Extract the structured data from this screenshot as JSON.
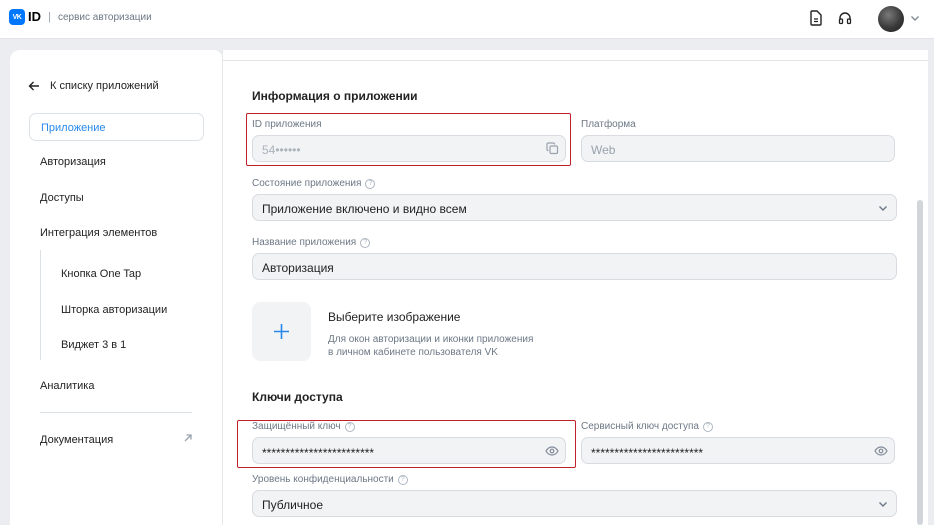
{
  "header": {
    "logo_badge": "VK",
    "logo_id": "ID",
    "separator": "|",
    "subtitle": "сервис авторизации"
  },
  "sidebar": {
    "back_label": "К списку приложений",
    "items": [
      {
        "label": "Приложение",
        "active": true
      },
      {
        "label": "Авторизация"
      },
      {
        "label": "Доступы"
      },
      {
        "label": "Интеграция элементов"
      }
    ],
    "sub_items": [
      {
        "label": "Кнопка One Tap"
      },
      {
        "label": "Шторка авторизации"
      },
      {
        "label": "Виджет 3 в 1"
      }
    ],
    "analytics_label": "Аналитика",
    "docs_label": "Документация"
  },
  "app_info": {
    "title": "Информация о приложении",
    "app_id_label": "ID приложения",
    "app_id_value": "54••••••",
    "platform_label": "Платформа",
    "platform_value": "Web",
    "state_label": "Состояние приложения",
    "state_value": "Приложение включено и видно всем",
    "name_label": "Название приложения",
    "name_value": "Авторизация",
    "image_title": "Выберите изображение",
    "image_desc_line1": "Для окон авторизации и иконки приложения",
    "image_desc_line2": "в личном кабинете пользователя VK"
  },
  "keys": {
    "title": "Ключи доступа",
    "secure_key_label": "Защищённый ключ",
    "secure_key_value": "************************",
    "service_key_label": "Сервисный ключ доступа",
    "service_key_value": "************************",
    "privacy_label": "Уровень конфиденциальности",
    "privacy_value": "Публичное"
  },
  "colors": {
    "accent": "#2688eb",
    "highlight": "#c0202a"
  }
}
